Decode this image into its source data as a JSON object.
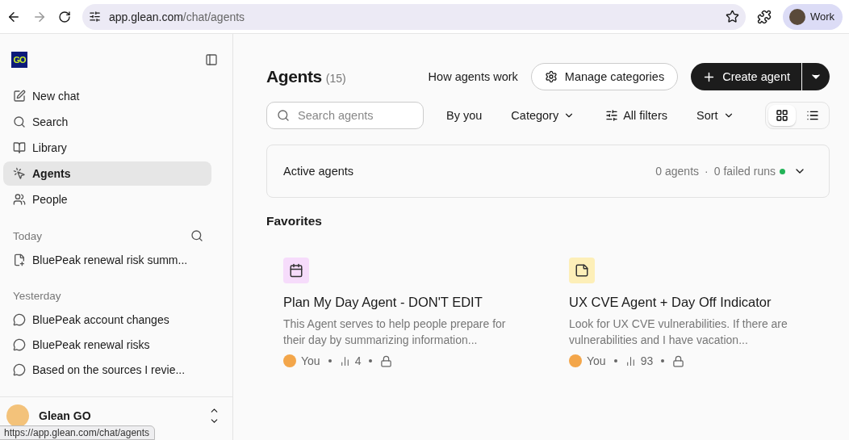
{
  "browser": {
    "url_host": "app.glean.com",
    "url_path": "/chat/agents",
    "profile": "Work"
  },
  "sidebar": {
    "logo": "GO",
    "nav": [
      {
        "label": "New chat",
        "selected": false
      },
      {
        "label": "Search",
        "selected": false
      },
      {
        "label": "Library",
        "selected": false
      },
      {
        "label": "Agents",
        "selected": true
      },
      {
        "label": "People",
        "selected": false
      }
    ],
    "sections": [
      {
        "title": "Today",
        "items": [
          {
            "label": "BluePeak renewal risk summ..."
          }
        ]
      },
      {
        "title": "Yesterday",
        "items": [
          {
            "label": "BluePeak account changes"
          },
          {
            "label": "BluePeak renewal risks"
          },
          {
            "label": "Based on the sources I revie..."
          }
        ]
      }
    ],
    "user": {
      "name": "Glean GO"
    }
  },
  "status_url": "https://app.glean.com/chat/agents",
  "header": {
    "title": "Agents",
    "count": "(15)",
    "link": "How agents work",
    "manage": "Manage categories",
    "create": "Create agent"
  },
  "filters": {
    "placeholder": "Search agents",
    "by_you": "By you",
    "category": "Category",
    "all_filters": "All filters",
    "sort": "Sort",
    "views": [
      {
        "kind": "grid",
        "selected": true
      },
      {
        "kind": "list",
        "selected": false
      }
    ]
  },
  "active": {
    "label": "Active agents",
    "agents": "0 agents",
    "separator": "·",
    "failed": "0 failed runs",
    "color": "#22b357"
  },
  "favorites": {
    "title": "Favorites",
    "cards": [
      {
        "color": "#f6dcfb",
        "title": "Plan My Day Agent - DON'T EDIT",
        "description": "This Agent serves to help people prepare for their day by summarizing information...",
        "owner": "You",
        "runs": "4"
      },
      {
        "color": "#fdefb8",
        "title": "UX CVE Agent + Day Off Indicator",
        "description": "Look for UX CVE vulnerabilities. If there are vulnerabilities and I have vacation...",
        "owner": "You",
        "runs": "93"
      }
    ]
  }
}
